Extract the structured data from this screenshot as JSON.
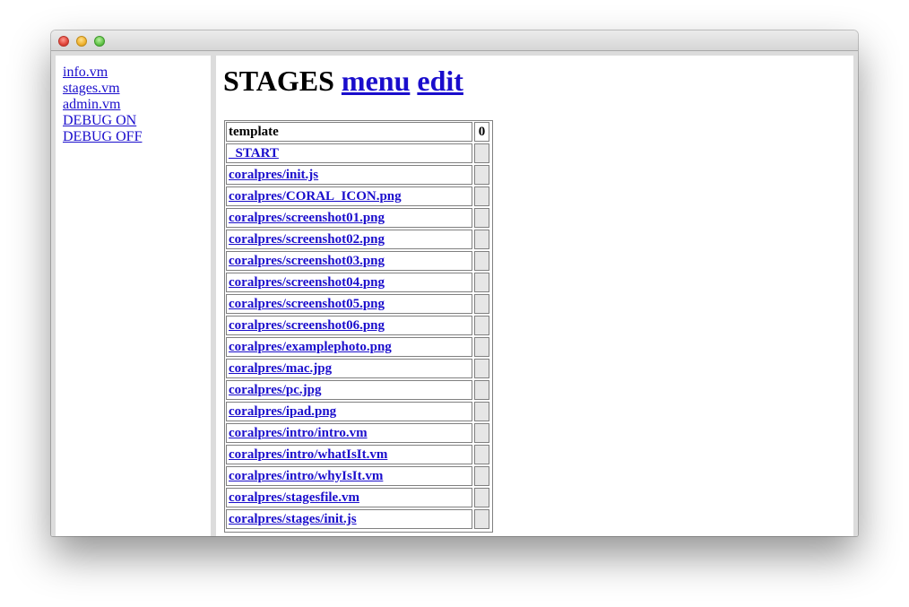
{
  "window": {
    "controls": [
      "close-button",
      "minimize-button",
      "zoom-button"
    ]
  },
  "sidebar": {
    "links": [
      {
        "label": "info.vm"
      },
      {
        "label": "stages.vm"
      },
      {
        "label": "admin.vm"
      },
      {
        "label": "DEBUG ON"
      },
      {
        "label": "DEBUG OFF"
      }
    ]
  },
  "main": {
    "title": "STAGES",
    "menu_link": "menu",
    "edit_link": "edit",
    "table": {
      "header_name": "template",
      "header_count": "0",
      "rows": [
        "_START",
        "coralpres/init.js",
        "coralpres/CORAL_ICON.png",
        "coralpres/screenshot01.png",
        "coralpres/screenshot02.png",
        "coralpres/screenshot03.png",
        "coralpres/screenshot04.png",
        "coralpres/screenshot05.png",
        "coralpres/screenshot06.png",
        "coralpres/examplephoto.png",
        "coralpres/mac.jpg",
        "coralpres/pc.jpg",
        "coralpres/ipad.png",
        "coralpres/intro/intro.vm",
        "coralpres/intro/whatIsIt.vm",
        "coralpres/intro/whyIsIt.vm",
        "coralpres/stagesfile.vm",
        "coralpres/stages/init.js"
      ]
    }
  }
}
